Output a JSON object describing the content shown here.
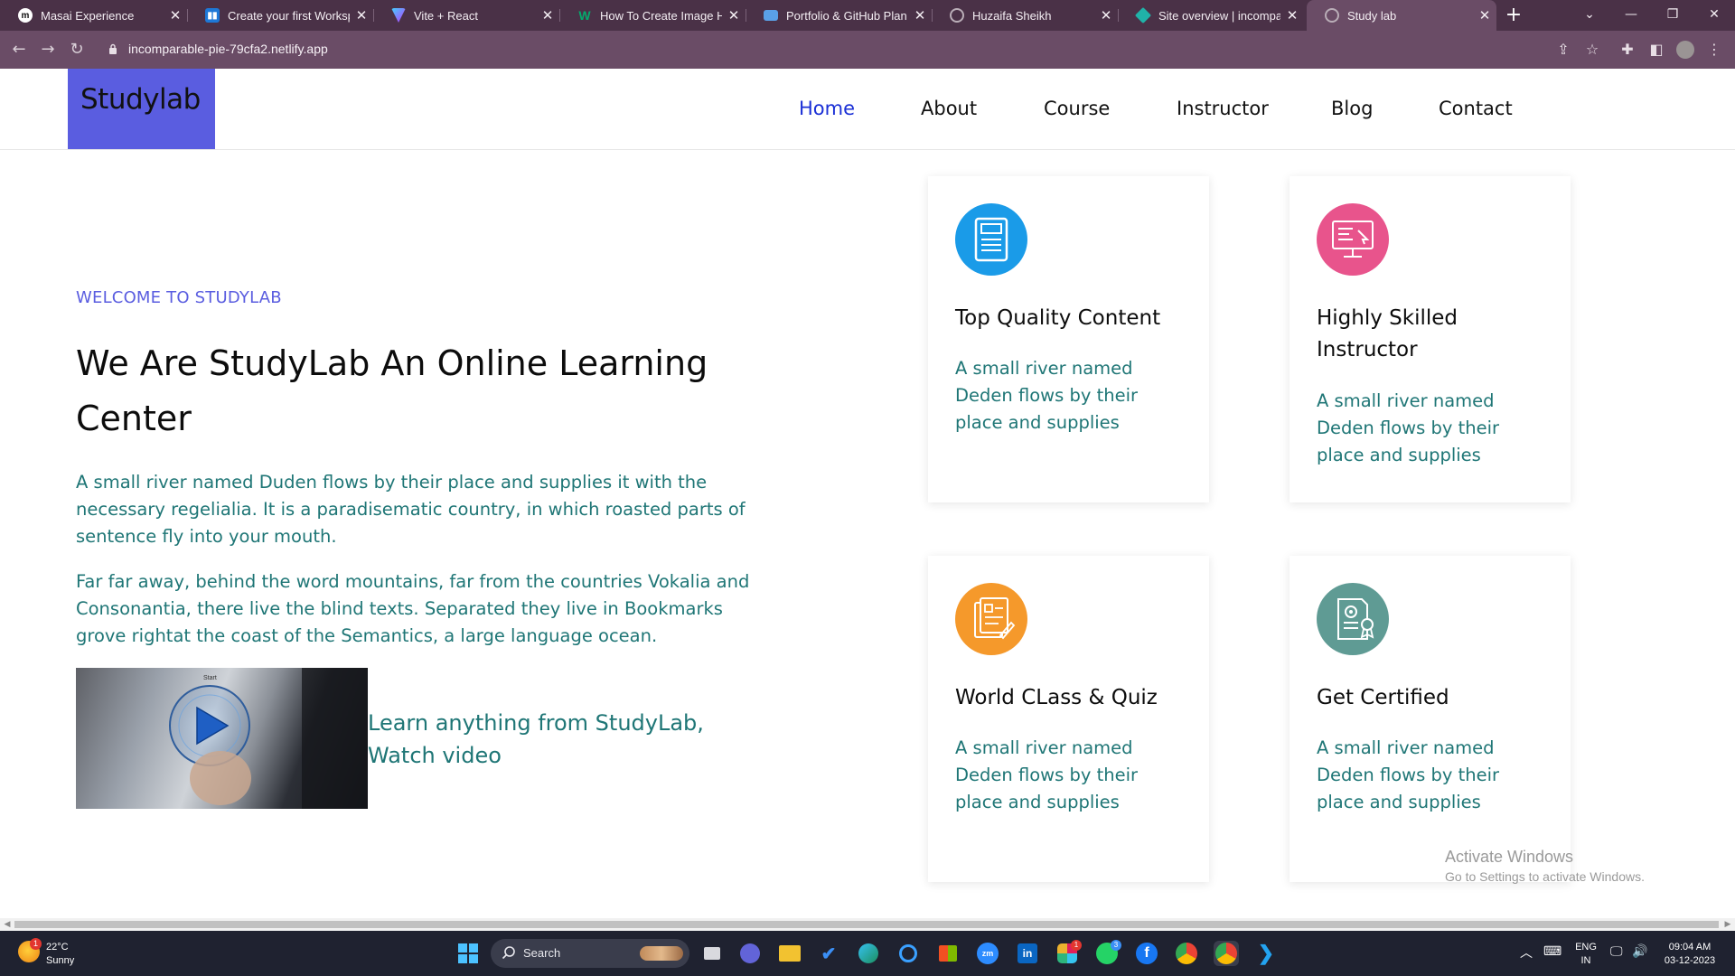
{
  "browser": {
    "tabs": [
      {
        "label": "Masai Experience",
        "icon": "masai-icon",
        "color": "#ffffff"
      },
      {
        "label": "Create your first Workspace",
        "icon": "trello-icon",
        "color": "#1e78d7"
      },
      {
        "label": "Vite + React",
        "icon": "vite-icon",
        "color": "#9b6cff"
      },
      {
        "label": "How To Create Image Hover",
        "icon": "w3-icon",
        "color": "#04aa6d"
      },
      {
        "label": "Portfolio & GitHub Plan",
        "icon": "laptop-icon",
        "color": "#5aa0e6"
      },
      {
        "label": "Huzaifa Sheikh",
        "icon": "globe-icon",
        "color": "#b9adb7"
      },
      {
        "label": "Site overview | incomparable",
        "icon": "netlify-icon",
        "color": "#20b2a8"
      },
      {
        "label": "Study lab",
        "icon": "globe-icon",
        "color": "#b9adb7"
      }
    ],
    "url": "incomparable-pie-79cfa2.netlify.app"
  },
  "site": {
    "logo": "Studylab",
    "nav": [
      "Home",
      "About",
      "Course",
      "Instructor",
      "Blog",
      "Contact"
    ],
    "active_nav": "Home"
  },
  "hero": {
    "welcome": "WELCOME TO STUDYLAB",
    "title": "We Are StudyLab An Online Learning Center",
    "para1": "A small river named Duden flows by their place and supplies it with the necessary regelialia. It is a paradisematic country, in which roasted parts of sentence fly into your mouth.",
    "para2": "Far far away, behind the word mountains, far from the countries Vokalia and Consonantia, there live the blind texts. Separated they live in Bookmarks grove rightat the coast of the Semantics, a large language ocean.",
    "video_caption": "Learn anything from StudyLab, Watch video",
    "video_start_label": "Start"
  },
  "features": [
    {
      "title": "Top Quality Content",
      "text": "A small river named Deden flows by their place and supplies",
      "icon": "document-icon",
      "color": "#1a9be8"
    },
    {
      "title": "Highly Skilled Instructor",
      "text": "A small river named Deden flows by their place and supplies",
      "icon": "monitor-icon",
      "color": "#e8548c"
    },
    {
      "title": "World CLass & Quiz",
      "text": "A small river named Deden flows by their place and supplies",
      "icon": "quiz-icon",
      "color": "#f5992b"
    },
    {
      "title": "Get Certified",
      "text": "A small river named Deden flows by their place and supplies",
      "icon": "certificate-icon",
      "color": "#5f9b94"
    }
  ],
  "activation": {
    "line1": "Activate Windows",
    "line2": "Go to Settings to activate Windows."
  },
  "taskbar": {
    "weather_temp": "22°C",
    "weather_desc": "Sunny",
    "weather_badge": "1",
    "search_placeholder": "Search",
    "whatsapp_badge": "3",
    "slack_badge": "1",
    "lang": "ENG",
    "region": "IN",
    "time": "09:04 AM",
    "date": "03-12-2023"
  }
}
